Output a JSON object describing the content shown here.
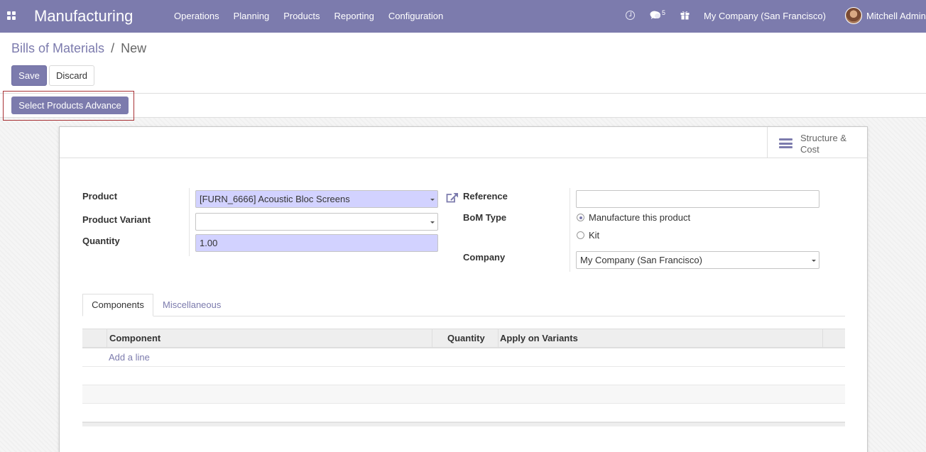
{
  "navbar": {
    "app_title": "Manufacturing",
    "menu": [
      "Operations",
      "Planning",
      "Products",
      "Reporting",
      "Configuration"
    ],
    "messages_count": "5",
    "company": "My Company (San Francisco)",
    "user": "Mitchell Admin",
    "color": "#7c7bad"
  },
  "breadcrumb": {
    "parent": "Bills of Materials",
    "separator": "/",
    "current": "New"
  },
  "actions": {
    "save": "Save",
    "discard": "Discard",
    "select_products_advance": "Select Products Advance"
  },
  "smart_button": {
    "label": "Structure & Cost"
  },
  "form": {
    "product_label": "Product",
    "product_value": "[FURN_6666] Acoustic Bloc Screens",
    "variant_label": "Product Variant",
    "variant_value": "",
    "quantity_label": "Quantity",
    "quantity_value": "1.00",
    "reference_label": "Reference",
    "reference_value": "",
    "bom_type_label": "BoM Type",
    "bom_type_options": [
      "Manufacture this product",
      "Kit"
    ],
    "bom_type_selected": "Manufacture this product",
    "company_label": "Company",
    "company_value": "My Company (San Francisco)"
  },
  "tabs": {
    "items": [
      "Components",
      "Miscellaneous"
    ],
    "active": "Components"
  },
  "table": {
    "columns": [
      "Component",
      "Quantity",
      "Apply on Variants"
    ],
    "add_line": "Add a line"
  }
}
